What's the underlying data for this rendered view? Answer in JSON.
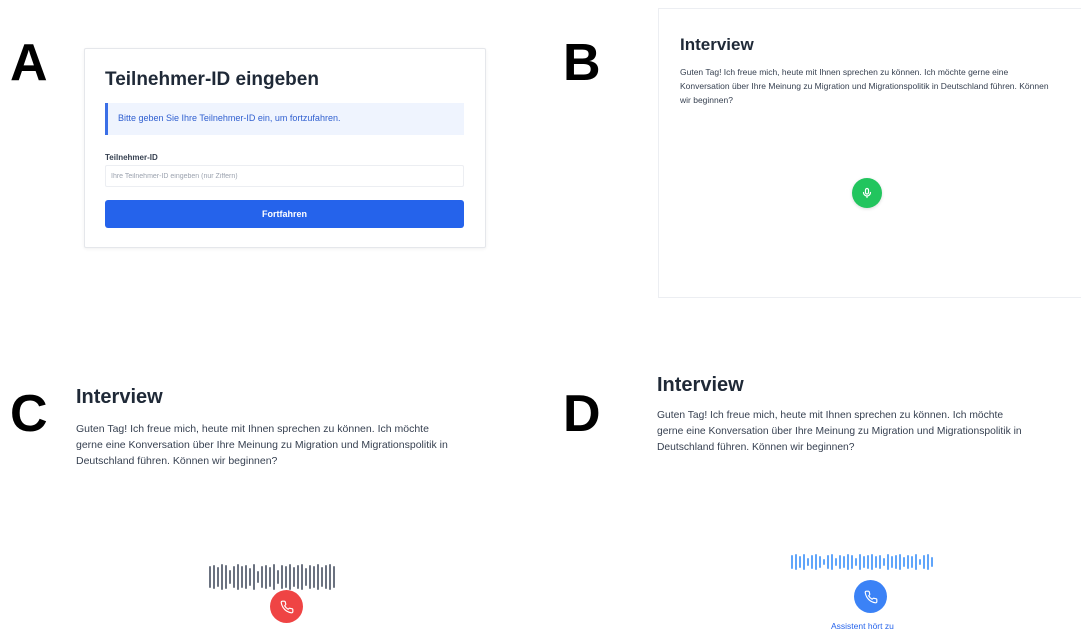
{
  "panels": {
    "a": {
      "letter": "A",
      "title": "Teilnehmer-ID eingeben",
      "info": "Bitte geben Sie Ihre Teilnehmer-ID ein, um fortzufahren.",
      "field_label": "Teilnehmer-ID",
      "field_placeholder": "Ihre Teilnehmer-ID eingeben (nur Ziffern)",
      "field_value": "",
      "button_label": "Fortfahren"
    },
    "b": {
      "letter": "B",
      "title": "Interview",
      "text": "Guten Tag! Ich freue mich, heute mit Ihnen sprechen zu können. Ich möchte gerne eine Konversation über Ihre Meinung zu Migration und Migrationspolitik in Deutschland führen. Können wir beginnen?",
      "mic_icon": "microphone-icon"
    },
    "c": {
      "letter": "C",
      "title": "Interview",
      "text_lines": [
        "Guten Tag! Ich freue mich, heute mit Ihnen sprechen zu können. Ich möchte",
        "gerne eine Konversation über Ihre Meinung zu Migration und Migrationspolitik in",
        "Deutschland führen. Können wir beginnen?"
      ],
      "call_icon": "phone-icon",
      "call_color": "#ef4444",
      "wave_color": "#6b7280"
    },
    "d": {
      "letter": "D",
      "title": "Interview",
      "text_lines": [
        "Guten Tag! Ich freue mich, heute mit Ihnen sprechen zu können. Ich möchte",
        "gerne eine Konversation über Ihre Meinung zu Migration und Migrationspolitik in",
        "Deutschland führen. Können wir beginnen?"
      ],
      "call_icon": "phone-icon",
      "call_color": "#3b82f6",
      "wave_color": "#60a5fa",
      "status": "Assistent hört zu"
    }
  }
}
